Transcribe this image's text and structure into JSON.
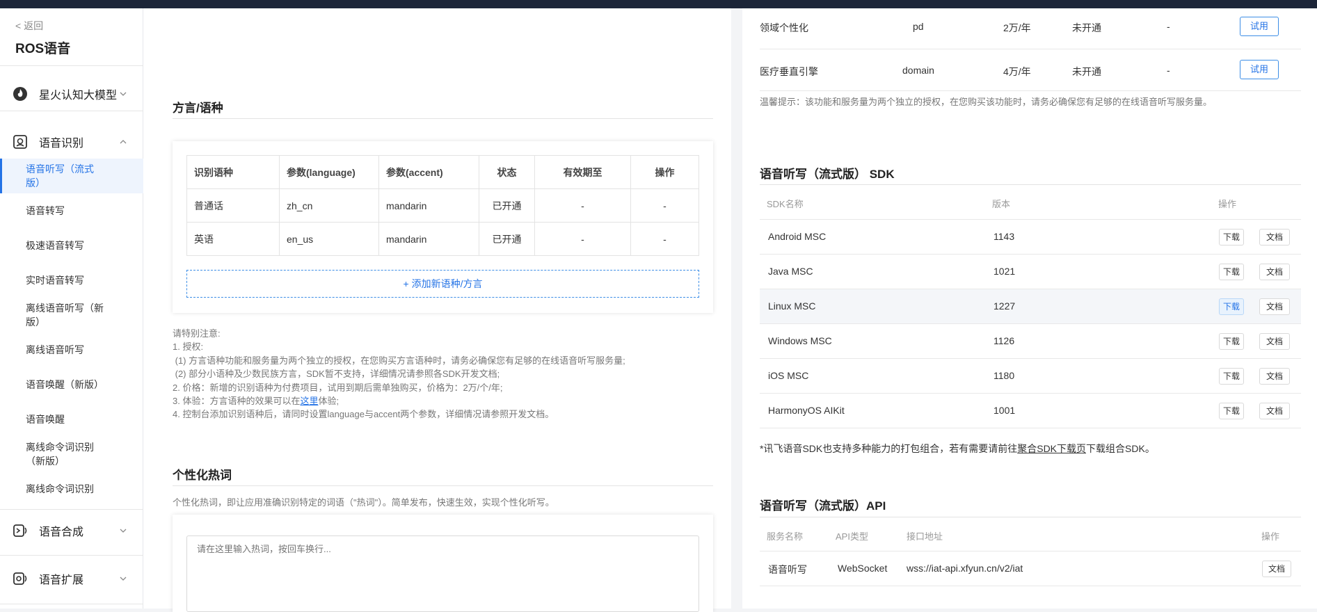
{
  "sidebar": {
    "back": "< 返回",
    "title": "ROS语音",
    "groups": [
      {
        "label": "星火认知大模型"
      },
      {
        "label": "语音识别"
      },
      {
        "label": "语音合成"
      },
      {
        "label": "语音扩展"
      }
    ],
    "items": [
      {
        "label": "语音听写（流式版）"
      },
      {
        "label": "语音转写"
      },
      {
        "label": "极速语音转写"
      },
      {
        "label": "实时语音转写"
      },
      {
        "label": "离线语音听写（新版）"
      },
      {
        "label": "离线语音听写"
      },
      {
        "label": "语音唤醒（新版）"
      },
      {
        "label": "语音唤醒"
      },
      {
        "label": "离线命令词识别（新版）"
      },
      {
        "label": "离线命令词识别"
      }
    ]
  },
  "dialect": {
    "title": "方言/语种",
    "headers": [
      "识别语种",
      "参数(language)",
      "参数(accent)",
      "状态",
      "有效期至",
      "操作"
    ],
    "rows": [
      [
        "普通话",
        "zh_cn",
        "mandarin",
        "已开通",
        "-",
        "-"
      ],
      [
        "英语",
        "en_us",
        "mandarin",
        "已开通",
        "-",
        "-"
      ]
    ],
    "add_label": "+ 添加新语种/方言",
    "notes": {
      "l0": "请特别注意:",
      "l1": "1. 授权:",
      "l2": " (1) 方言语种功能和服务量为两个独立的授权，在您购买方言语种时，请务必确保您有足够的在线语音听写服务量;",
      "l3": " (2) 部分小语种及少数民族方言，SDK暂不支持，详细情况请参照各SDK开发文档;",
      "l4": "2. 价格：新增的识别语种为付费项目，试用到期后需单独购买，价格为：2万/个/年;",
      "l5a": "3. 体验：方言语种的效果可以在",
      "l5link": "这里",
      "l5b": "体验;",
      "l6": "4. 控制台添加识别语种后，请同时设置language与accent两个参数，详细情况请参照开发文档。"
    }
  },
  "hotword": {
    "title": "个性化热词",
    "desc": "个性化热词，即让应用准确识别特定的词语（\"热词\"）。简单发布，快速生效，实现个性化听写。",
    "placeholder": "请在这里输入热词，按回车换行..."
  },
  "features": {
    "rows": [
      {
        "name": "领域个性化",
        "param": "pd",
        "price": "2万/年",
        "status": "未开通",
        "expiry": "-",
        "action": "试用"
      },
      {
        "name": "医疗垂直引擎",
        "param": "domain",
        "price": "4万/年",
        "status": "未开通",
        "expiry": "-",
        "action": "试用"
      }
    ],
    "tip": "温馨提示：该功能和服务量为两个独立的授权，在您购买该功能时，请务必确保您有足够的在线语音听写服务量。"
  },
  "sdk": {
    "title": "语音听写（流式版） SDK",
    "headers": {
      "name": "SDK名称",
      "version": "版本",
      "action": "操作"
    },
    "download": "下载",
    "doc": "文档",
    "rows": [
      {
        "name": "Android MSC",
        "version": "1143"
      },
      {
        "name": "Java MSC",
        "version": "1021"
      },
      {
        "name": "Linux MSC",
        "version": "1227"
      },
      {
        "name": "Windows MSC",
        "version": "1126"
      },
      {
        "name": "iOS MSC",
        "version": "1180"
      },
      {
        "name": "HarmonyOS AIKit",
        "version": "1001"
      }
    ],
    "footnote_a": "*讯飞语音SDK也支持多种能力的打包组合，若有需要请前往",
    "footnote_link": "聚合SDK下载页",
    "footnote_b": "下载组合SDK。"
  },
  "api": {
    "title": "语音听写（流式版）API",
    "headers": {
      "service": "服务名称",
      "type": "API类型",
      "url": "接口地址",
      "action": "操作"
    },
    "rows": [
      {
        "service": "语音听写",
        "type": "WebSocket",
        "url": "wss://iat-api.xfyun.cn/v2/iat",
        "action": "文档"
      }
    ]
  }
}
